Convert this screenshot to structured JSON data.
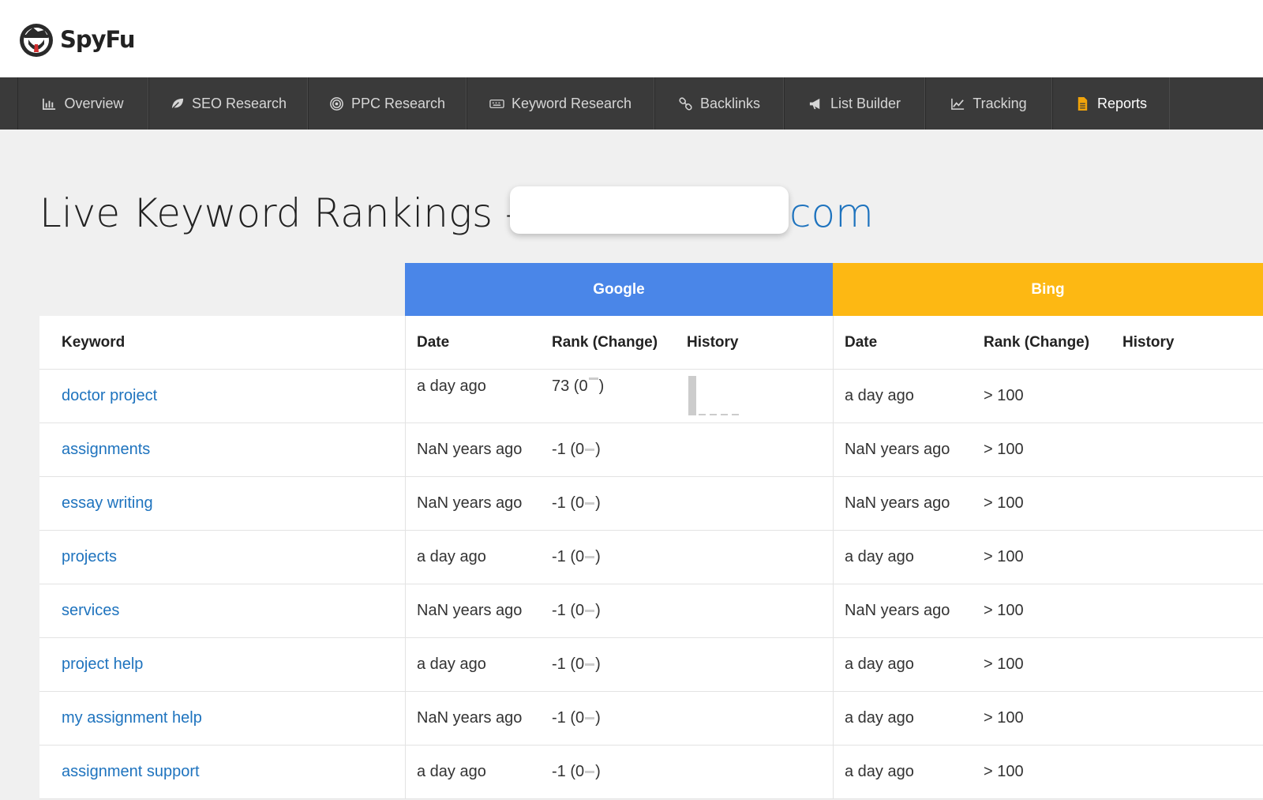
{
  "brand": {
    "name": "SpyFu"
  },
  "nav": {
    "items": [
      {
        "label": "Overview",
        "icon": "bar-chart-icon"
      },
      {
        "label": "SEO Research",
        "icon": "leaf-icon"
      },
      {
        "label": "PPC Research",
        "icon": "target-icon"
      },
      {
        "label": "Keyword Research",
        "icon": "keyboard-icon"
      },
      {
        "label": "Backlinks",
        "icon": "link-icon"
      },
      {
        "label": "List Builder",
        "icon": "megaphone-icon"
      },
      {
        "label": "Tracking",
        "icon": "line-chart-icon"
      },
      {
        "label": "Reports",
        "icon": "document-icon"
      }
    ],
    "active": "Reports"
  },
  "page": {
    "title": "Live Keyword Rankings -",
    "domain_visible": "com"
  },
  "engines": {
    "google": "Google",
    "bing": "Bing"
  },
  "columns": {
    "keyword": "Keyword",
    "google_date": "Date",
    "google_rank": "Rank (Change)",
    "google_history": "History",
    "bing_date": "Date",
    "bing_rank": "Rank (Change)",
    "bing_history": "History"
  },
  "rows": [
    {
      "keyword": "doctor project",
      "g_date": "a day ago",
      "g_rank": "73 (0",
      "b_date": "a day ago",
      "b_rank": "> 100"
    },
    {
      "keyword": "assignments",
      "g_date": "NaN years ago",
      "g_rank": "-1 (0",
      "b_date": "NaN years ago",
      "b_rank": "> 100"
    },
    {
      "keyword": "essay writing",
      "g_date": "NaN years ago",
      "g_rank": "-1 (0",
      "b_date": "NaN years ago",
      "b_rank": "> 100"
    },
    {
      "keyword": "projects",
      "g_date": "a day ago",
      "g_rank": "-1 (0",
      "b_date": "a day ago",
      "b_rank": "> 100"
    },
    {
      "keyword": "services",
      "g_date": "NaN years ago",
      "g_rank": "-1 (0",
      "b_date": "NaN years ago",
      "b_rank": "> 100"
    },
    {
      "keyword": "project help",
      "g_date": "a day ago",
      "g_rank": "-1 (0",
      "b_date": "a day ago",
      "b_rank": "> 100"
    },
    {
      "keyword": "my assignment help",
      "g_date": "NaN years ago",
      "g_rank": "-1 (0",
      "b_date": "a day ago",
      "b_rank": "> 100"
    },
    {
      "keyword": "assignment support",
      "g_date": "a day ago",
      "g_rank": "-1 (0",
      "b_date": "a day ago",
      "b_rank": "> 100"
    }
  ],
  "colors": {
    "google": "#4a86e8",
    "bing": "#fdb813",
    "link": "#1e73be",
    "nav_bg": "#3a3a3a",
    "reports_icon": "#f0a30a"
  }
}
